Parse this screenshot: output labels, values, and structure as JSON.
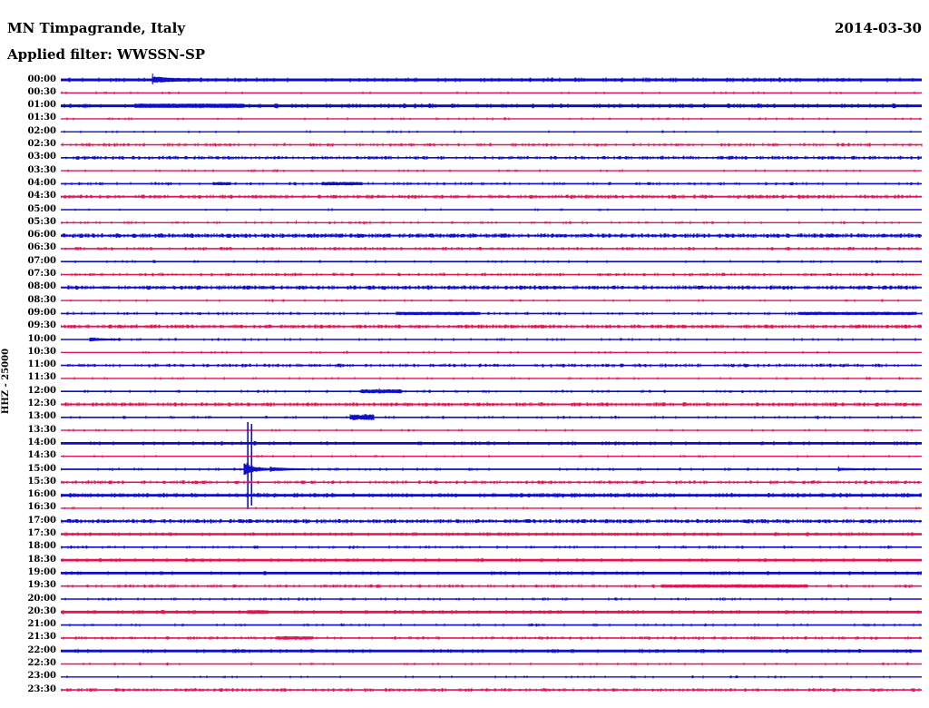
{
  "header": {
    "station": "MN Timpagrande, Italy",
    "date": "2014-03-30",
    "filter_label": "Applied filter: WWSSN-SP"
  },
  "y_axis_label": "HHZ - 25000",
  "chart_data": {
    "type": "line",
    "subtype": "helicorder-seismogram",
    "title": "MN Timpagrande, Italy",
    "date": "2014-03-30",
    "applied_filter": "WWSSN-SP",
    "channel": "HHZ",
    "scale": 25000,
    "minutes_per_row": 30,
    "legend_position": "none",
    "grid": false,
    "trace_colors": {
      "blue": "#0d0dca",
      "red": "#e11550"
    },
    "rows": [
      {
        "t": "00:00",
        "color": "blue",
        "base": 1.5,
        "noise_density": 0.12,
        "noise_amp": 0.8,
        "events": [
          {
            "type": "spike",
            "m": 3.2,
            "up": 7,
            "dn": 5
          },
          {
            "type": "burst",
            "m0": 3.2,
            "m1": 4.8,
            "amp": 3,
            "decay": true
          }
        ]
      },
      {
        "t": "00:30",
        "color": "red",
        "base": 0.7,
        "noise_density": 0.04,
        "noise_amp": 0.6,
        "events": []
      },
      {
        "t": "01:00",
        "color": "blue",
        "base": 1.5,
        "noise_density": 0.15,
        "noise_amp": 0.8,
        "events": [
          {
            "type": "burst",
            "m0": 2.6,
            "m1": 6.4,
            "amp": 1.0,
            "decay": false
          }
        ]
      },
      {
        "t": "01:30",
        "color": "red",
        "base": 0.7,
        "noise_density": 0.06,
        "noise_amp": 0.7,
        "events": []
      },
      {
        "t": "02:00",
        "color": "blue",
        "base": 0.7,
        "noise_density": 0.05,
        "noise_amp": 0.6,
        "events": []
      },
      {
        "t": "02:30",
        "color": "red",
        "base": 0.8,
        "noise_density": 0.22,
        "noise_amp": 0.9,
        "events": []
      },
      {
        "t": "03:00",
        "color": "blue",
        "base": 0.8,
        "noise_density": 0.32,
        "noise_amp": 1.0,
        "events": []
      },
      {
        "t": "03:30",
        "color": "red",
        "base": 0.7,
        "noise_density": 0.05,
        "noise_amp": 0.6,
        "events": []
      },
      {
        "t": "04:00",
        "color": "blue",
        "base": 0.8,
        "noise_density": 0.14,
        "noise_amp": 0.8,
        "events": [
          {
            "type": "burst",
            "m0": 5.3,
            "m1": 5.9,
            "amp": 1.1,
            "decay": false
          },
          {
            "type": "burst",
            "m0": 9.1,
            "m1": 10.5,
            "amp": 1.3,
            "decay": false
          }
        ]
      },
      {
        "t": "04:30",
        "color": "red",
        "base": 0.9,
        "noise_density": 0.32,
        "noise_amp": 1.0,
        "events": []
      },
      {
        "t": "05:00",
        "color": "blue",
        "base": 0.7,
        "noise_density": 0.04,
        "noise_amp": 0.6,
        "events": []
      },
      {
        "t": "05:30",
        "color": "red",
        "base": 0.7,
        "noise_density": 0.12,
        "noise_amp": 0.7,
        "events": [
          {
            "type": "spike",
            "m": 8.2,
            "up": 2.5,
            "dn": 1.5
          }
        ]
      },
      {
        "t": "06:00",
        "color": "blue",
        "base": 1.0,
        "noise_density": 0.5,
        "noise_amp": 1.1,
        "events": []
      },
      {
        "t": "06:30",
        "color": "red",
        "base": 0.8,
        "noise_density": 0.22,
        "noise_amp": 0.8,
        "events": []
      },
      {
        "t": "07:00",
        "color": "blue",
        "base": 0.8,
        "noise_density": 0.06,
        "noise_amp": 0.6,
        "events": [
          {
            "type": "spike",
            "m": 2.5,
            "up": 1.8,
            "dn": 1.2
          }
        ]
      },
      {
        "t": "07:30",
        "color": "red",
        "base": 0.8,
        "noise_density": 0.22,
        "noise_amp": 0.8,
        "events": []
      },
      {
        "t": "08:00",
        "color": "blue",
        "base": 1.0,
        "noise_density": 0.42,
        "noise_amp": 1.0,
        "events": []
      },
      {
        "t": "08:30",
        "color": "red",
        "base": 0.7,
        "noise_density": 0.05,
        "noise_amp": 0.6,
        "events": []
      },
      {
        "t": "09:00",
        "color": "blue",
        "base": 0.8,
        "noise_density": 0.16,
        "noise_amp": 0.8,
        "events": [
          {
            "type": "burst",
            "m0": 11.7,
            "m1": 14.6,
            "amp": 1.1,
            "decay": false
          },
          {
            "type": "burst",
            "m0": 25.7,
            "m1": 29.8,
            "amp": 1.1,
            "decay": false
          }
        ]
      },
      {
        "t": "09:30",
        "color": "red",
        "base": 0.9,
        "noise_density": 0.42,
        "noise_amp": 0.9,
        "events": [
          {
            "type": "spike",
            "m": 4.4,
            "up": 2,
            "dn": 1.5
          }
        ]
      },
      {
        "t": "10:00",
        "color": "blue",
        "base": 0.8,
        "noise_density": 0.1,
        "noise_amp": 0.7,
        "events": [
          {
            "type": "burst",
            "m0": 1.0,
            "m1": 2.1,
            "amp": 2.2,
            "decay": true
          }
        ]
      },
      {
        "t": "10:30",
        "color": "red",
        "base": 0.7,
        "noise_density": 0.05,
        "noise_amp": 0.6,
        "events": []
      },
      {
        "t": "11:00",
        "color": "blue",
        "base": 0.8,
        "noise_density": 0.28,
        "noise_amp": 0.9,
        "events": []
      },
      {
        "t": "11:30",
        "color": "red",
        "base": 0.7,
        "noise_density": 0.06,
        "noise_amp": 0.6,
        "events": []
      },
      {
        "t": "12:00",
        "color": "blue",
        "base": 0.8,
        "noise_density": 0.12,
        "noise_amp": 0.7,
        "events": [
          {
            "type": "burst",
            "m0": 10.5,
            "m1": 11.9,
            "amp": 1.6,
            "decay": false
          },
          {
            "type": "spike",
            "m": 11.1,
            "up": 3.5,
            "dn": 2.5
          }
        ]
      },
      {
        "t": "12:30",
        "color": "red",
        "base": 1.0,
        "noise_density": 0.28,
        "noise_amp": 0.9,
        "events": []
      },
      {
        "t": "13:00",
        "color": "blue",
        "base": 0.8,
        "noise_density": 0.1,
        "noise_amp": 0.7,
        "events": [
          {
            "type": "burst",
            "m0": 10.1,
            "m1": 10.9,
            "amp": 2.8,
            "decay": false
          }
        ]
      },
      {
        "t": "13:30",
        "color": "red",
        "base": 0.7,
        "noise_density": 0.05,
        "noise_amp": 0.6,
        "events": []
      },
      {
        "t": "14:00",
        "color": "blue",
        "base": 1.4,
        "noise_density": 0.08,
        "noise_amp": 0.7,
        "events": []
      },
      {
        "t": "14:30",
        "color": "red",
        "base": 0.7,
        "noise_density": 0.06,
        "noise_amp": 0.6,
        "events": []
      },
      {
        "t": "15:00",
        "color": "blue",
        "base": 0.9,
        "noise_density": 0.1,
        "noise_amp": 0.7,
        "events": [
          {
            "type": "impulse",
            "m": 6.51,
            "up": 52,
            "dn": 44
          },
          {
            "type": "impulse",
            "m": 6.64,
            "up": 50,
            "dn": 40
          },
          {
            "type": "burst",
            "m0": 6.4,
            "m1": 7.4,
            "amp": 8,
            "decay": true
          },
          {
            "type": "burst",
            "m0": 7.3,
            "m1": 8.5,
            "amp": 2.5,
            "decay": true
          },
          {
            "type": "spike",
            "m": 27.1,
            "up": 3,
            "dn": 2.5
          },
          {
            "type": "burst",
            "m0": 27.1,
            "m1": 28.4,
            "amp": 1.1,
            "decay": true
          }
        ]
      },
      {
        "t": "15:30",
        "color": "red",
        "base": 0.8,
        "noise_density": 0.28,
        "noise_amp": 0.9,
        "events": []
      },
      {
        "t": "16:00",
        "color": "blue",
        "base": 1.4,
        "noise_density": 0.2,
        "noise_amp": 0.8,
        "events": []
      },
      {
        "t": "16:30",
        "color": "red",
        "base": 0.7,
        "noise_density": 0.05,
        "noise_amp": 0.6,
        "events": []
      },
      {
        "t": "17:00",
        "color": "blue",
        "base": 0.9,
        "noise_density": 0.5,
        "noise_amp": 1.1,
        "events": []
      },
      {
        "t": "17:30",
        "color": "red",
        "base": 1.2,
        "noise_density": 0.15,
        "noise_amp": 0.6,
        "events": []
      },
      {
        "t": "18:00",
        "color": "blue",
        "base": 0.8,
        "noise_density": 0.12,
        "noise_amp": 0.7,
        "events": []
      },
      {
        "t": "18:30",
        "color": "red",
        "base": 1.4,
        "noise_density": 0.08,
        "noise_amp": 0.5,
        "events": []
      },
      {
        "t": "19:00",
        "color": "blue",
        "base": 1.4,
        "noise_density": 0.08,
        "noise_amp": 0.5,
        "events": []
      },
      {
        "t": "19:30",
        "color": "red",
        "base": 0.8,
        "noise_density": 0.2,
        "noise_amp": 0.8,
        "events": [
          {
            "type": "burst",
            "m0": 21.0,
            "m1": 26.0,
            "amp": 1.2,
            "decay": false
          }
        ]
      },
      {
        "t": "20:00",
        "color": "blue",
        "base": 0.8,
        "noise_density": 0.1,
        "noise_amp": 0.7,
        "events": []
      },
      {
        "t": "20:30",
        "color": "red",
        "base": 1.4,
        "noise_density": 0.1,
        "noise_amp": 0.6,
        "events": [
          {
            "type": "spike",
            "m": 6.6,
            "up": 1,
            "dn": 2
          },
          {
            "type": "burst",
            "m0": 6.5,
            "m1": 7.2,
            "amp": 0.8,
            "decay": false
          }
        ]
      },
      {
        "t": "21:00",
        "color": "blue",
        "base": 0.8,
        "noise_density": 0.08,
        "noise_amp": 0.6,
        "events": []
      },
      {
        "t": "21:30",
        "color": "red",
        "base": 0.8,
        "noise_density": 0.22,
        "noise_amp": 0.8,
        "events": [
          {
            "type": "burst",
            "m0": 7.5,
            "m1": 8.8,
            "amp": 1.3,
            "decay": false
          }
        ]
      },
      {
        "t": "22:00",
        "color": "blue",
        "base": 1.4,
        "noise_density": 0.1,
        "noise_amp": 0.6,
        "events": []
      },
      {
        "t": "22:30",
        "color": "red",
        "base": 0.7,
        "noise_density": 0.06,
        "noise_amp": 0.6,
        "events": []
      },
      {
        "t": "23:00",
        "color": "blue",
        "base": 0.7,
        "noise_density": 0.06,
        "noise_amp": 0.6,
        "events": []
      },
      {
        "t": "23:30",
        "color": "red",
        "base": 0.8,
        "noise_density": 0.28,
        "noise_amp": 0.9,
        "events": []
      }
    ]
  }
}
